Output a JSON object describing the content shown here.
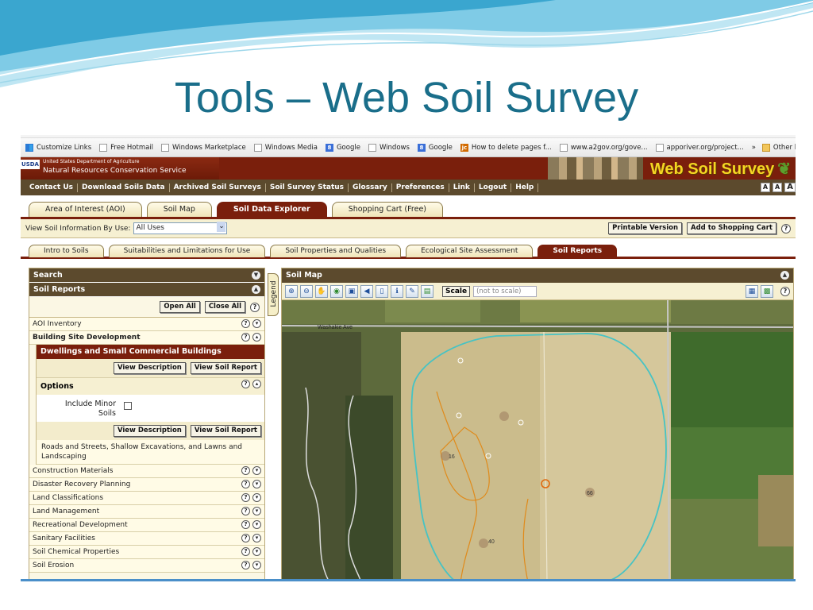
{
  "slide": {
    "title": "Tools – Web Soil Survey"
  },
  "bookmarks": [
    "Customize Links",
    "Free Hotmail",
    "Windows Marketplace",
    "Windows Media",
    "Google",
    "Windows",
    "Google",
    "How to delete pages f...",
    "www.a2gov.org/gove...",
    "apporiver.org/project..."
  ],
  "bookmarks_more": "»",
  "bookmarks_other": "Other bookm",
  "header": {
    "usda": "USDA",
    "department": "United States Department of Agriculture",
    "agency": "Natural Resources Conservation Service",
    "logo": "Web Soil Survey"
  },
  "topnav": [
    "Contact Us",
    "Download Soils Data",
    "Archived Soil Surveys",
    "Soil Survey Status",
    "Glossary",
    "Preferences",
    "Link",
    "Logout",
    "Help"
  ],
  "text_sizes": [
    "A",
    "A",
    "A"
  ],
  "main_tabs": [
    "Area of Interest (AOI)",
    "Soil Map",
    "Soil Data Explorer",
    "Shopping Cart (Free)"
  ],
  "viewbar": {
    "label": "View Soil Information By Use:",
    "selected": "All Uses",
    "printable": "Printable Version",
    "add_cart": "Add to Shopping Cart"
  },
  "sub_tabs": [
    "Intro to Soils",
    "Suitabilities and Limitations for Use",
    "Soil Properties and Qualities",
    "Ecological Site Assessment",
    "Soil Reports"
  ],
  "left": {
    "search": "Search",
    "soil_reports": "Soil Reports",
    "open_all": "Open All",
    "close_all": "Close All",
    "aoi_inventory": "AOI Inventory",
    "building_site": "Building Site Development",
    "dwellings": "Dwellings and Small Commercial Buildings",
    "view_description": "View Description",
    "view_soil_report": "View Soil Report",
    "options": "Options",
    "include_minor": "Include Minor Soils",
    "roads": "Roads and Streets, Shallow Excavations, and Lawns and Landscaping",
    "categories": [
      "Construction Materials",
      "Disaster Recovery Planning",
      "Land Classifications",
      "Land Management",
      "Recreational Development",
      "Sanitary Facilities",
      "Soil Chemical Properties",
      "Soil Erosion"
    ]
  },
  "map": {
    "legend": "Legend",
    "title": "Soil Map",
    "scale_label": "Scale",
    "scale_value": "(not to scale)",
    "street_labels": [
      "Washakie Ave"
    ],
    "map_units": [
      "40",
      "16",
      "66"
    ]
  }
}
